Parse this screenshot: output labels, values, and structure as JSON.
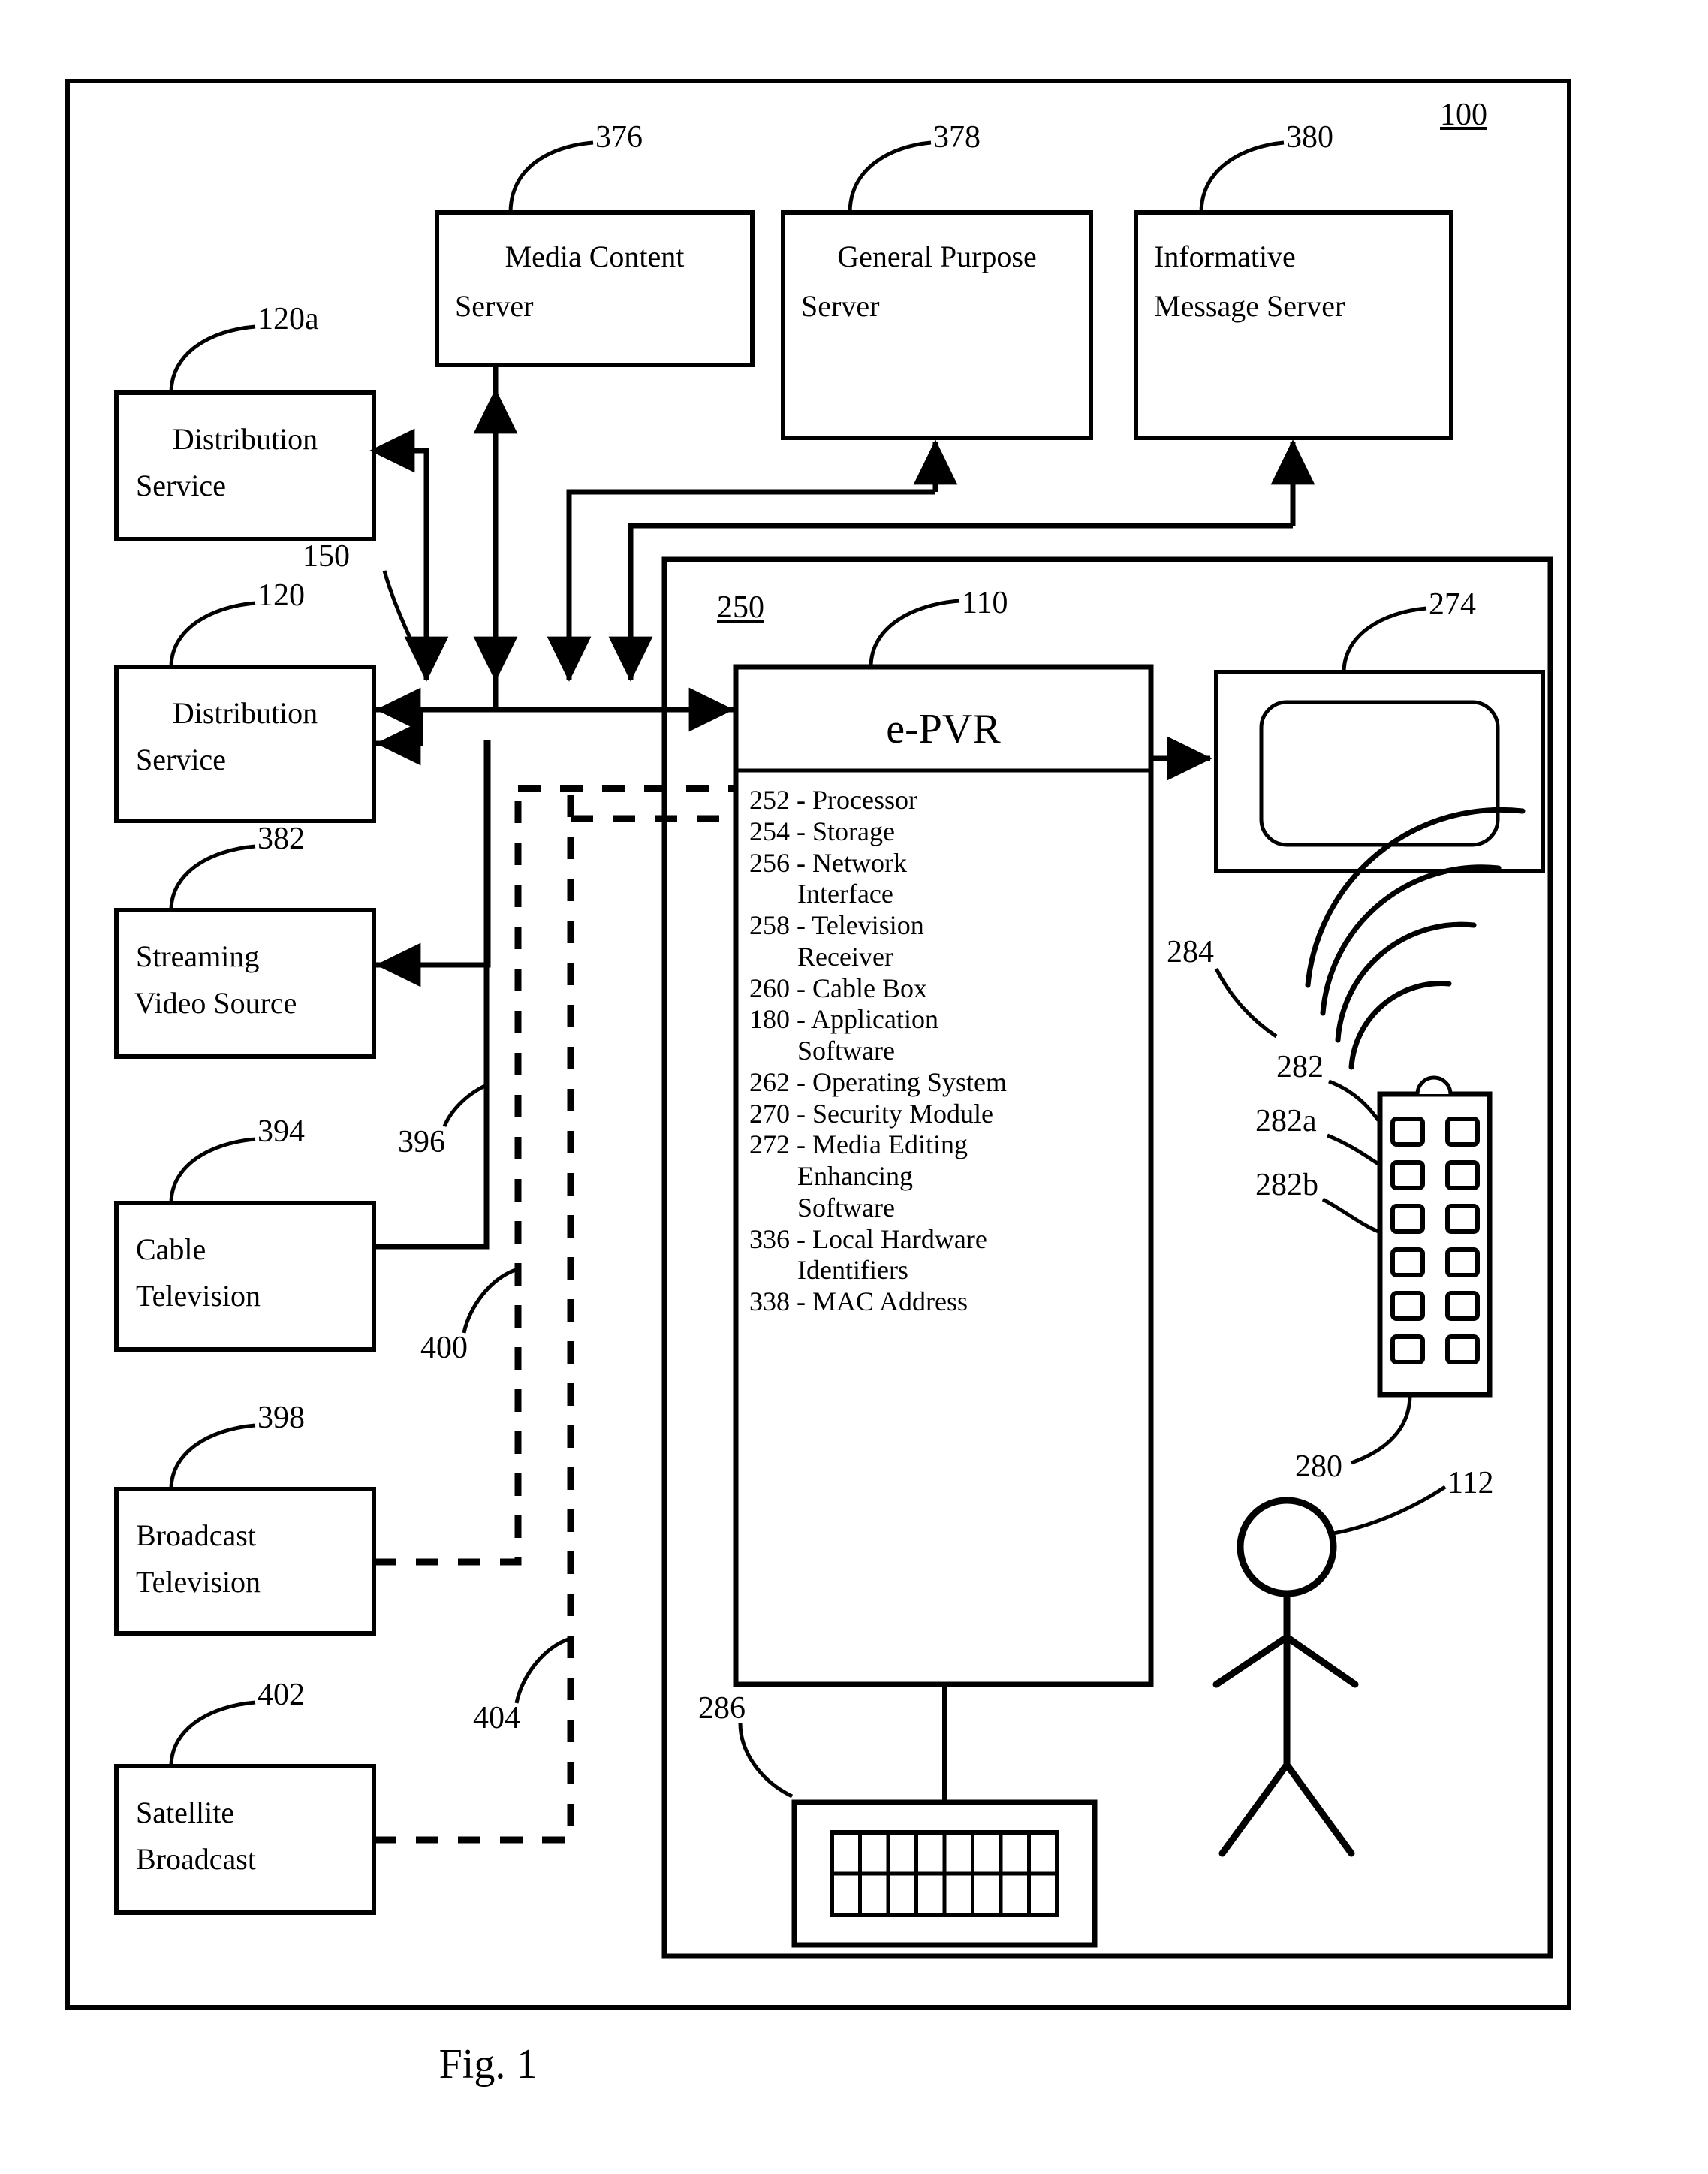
{
  "figure": {
    "caption": "Fig. 1",
    "system_ref": "100"
  },
  "outer_frame": {
    "name": "system-boundary"
  },
  "servers": [
    {
      "ref": "376",
      "label_line1": "Media Content",
      "label_line2": "Server",
      "name": "media-content-server"
    },
    {
      "ref": "378",
      "label_line1": "General Purpose",
      "label_line2": "Server",
      "name": "general-purpose-server"
    },
    {
      "ref": "380",
      "label_line1": "Informative",
      "label_line2": "Message Server",
      "name": "informative-message-server"
    }
  ],
  "sources": [
    {
      "ref": "120a",
      "label_line1": "Distribution",
      "label_line2": "Service",
      "name": "distribution-service-a"
    },
    {
      "ref": "120",
      "label_line1": "Distribution",
      "label_line2": "Service",
      "name": "distribution-service"
    },
    {
      "ref": "382",
      "label_line1": "Streaming",
      "label_line2": "Video Source",
      "name": "streaming-video-source"
    },
    {
      "ref": "394",
      "label_line1": "Cable",
      "label_line2": "Television",
      "name": "cable-television"
    },
    {
      "ref": "398",
      "label_line1": "Broadcast",
      "label_line2": "Television",
      "name": "broadcast-television"
    },
    {
      "ref": "402",
      "label_line1": "Satellite",
      "label_line2": "Broadcast",
      "name": "satellite-broadcast"
    }
  ],
  "connection_refs": [
    {
      "ref": "150",
      "name": "network-link-150"
    },
    {
      "ref": "396",
      "name": "cable-link-396"
    },
    {
      "ref": "400",
      "name": "broadcast-link-400"
    },
    {
      "ref": "404",
      "name": "satellite-link-404"
    }
  ],
  "premises": {
    "ref": "250",
    "name": "user-premises-boundary"
  },
  "epvr": {
    "ref": "110",
    "title": "e-PVR",
    "components": [
      {
        "ref": "252",
        "label": "Processor"
      },
      {
        "ref": "254",
        "label": "Storage"
      },
      {
        "ref": "256",
        "label": "Network",
        "cont": "Interface"
      },
      {
        "ref": "258",
        "label": "Television",
        "cont": "Receiver"
      },
      {
        "ref": "260",
        "label": "Cable Box"
      },
      {
        "ref": "180",
        "label": "Application",
        "cont": "Software"
      },
      {
        "ref": "262",
        "label": "Operating System"
      },
      {
        "ref": "270",
        "label": "Security Module"
      },
      {
        "ref": "272",
        "label": "Media Editing",
        "cont": "Enhancing",
        "cont2": "Software"
      },
      {
        "ref": "336",
        "label": "Local Hardware",
        "cont": "Identifiers"
      },
      {
        "ref": "338",
        "label": "MAC Address"
      }
    ]
  },
  "display": {
    "ref": "274",
    "name": "television-display"
  },
  "wireless": {
    "ref": "284",
    "name": "wireless-signal"
  },
  "remote": {
    "ref": "280",
    "body_ref": "282",
    "button_a_ref": "282a",
    "button_b_ref": "282b",
    "name": "remote-control",
    "button_rows": 6,
    "button_cols": 2
  },
  "keyboard": {
    "ref": "286",
    "name": "keyboard",
    "key_rows": 2,
    "key_cols": 8
  },
  "user": {
    "ref": "112",
    "name": "user-stick-figure"
  },
  "colors": {
    "line": "#000000",
    "background": "#ffffff"
  }
}
